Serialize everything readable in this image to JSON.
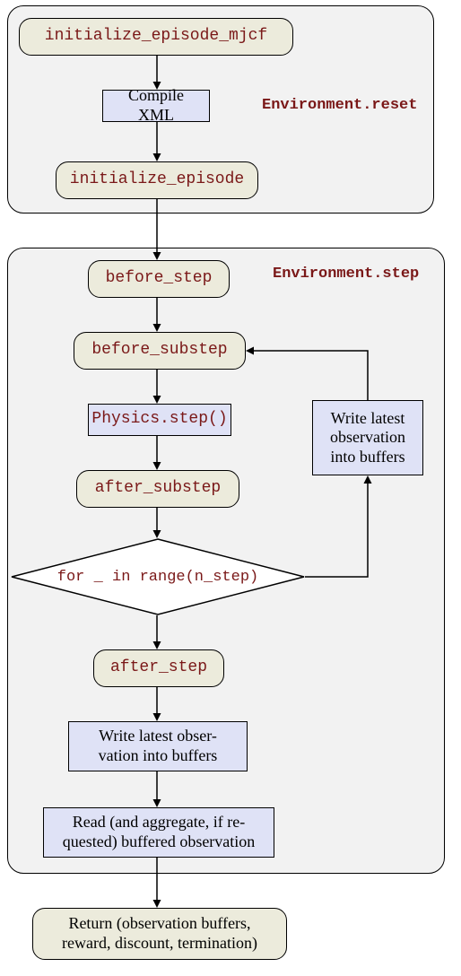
{
  "reset": {
    "panel_label": "Environment.reset",
    "init_mjcf": "initialize_episode_mjcf",
    "compile": "Compile XML",
    "init_episode": "initialize_episode"
  },
  "step": {
    "panel_label": "Environment.step",
    "before_step": "before_step",
    "before_substep": "before_substep",
    "physics": "Physics.step()",
    "after_substep": "after_substep",
    "loop": "for _ in range(n_step)",
    "loop_side": "Write latest observation into buffers",
    "after_step": "after_step",
    "write_obs": "Write latest obser-\nvation into buffers",
    "read_obs": "Read (and aggregate, if re-\nquested) buffered observation"
  },
  "return": "Return (observation buffers,\nreward, discount, termination)"
}
